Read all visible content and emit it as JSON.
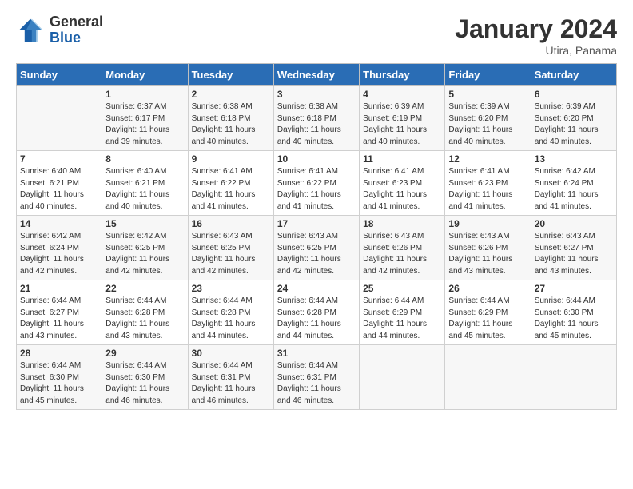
{
  "logo": {
    "general": "General",
    "blue": "Blue"
  },
  "header": {
    "title": "January 2024",
    "subtitle": "Utira, Panama"
  },
  "days_of_week": [
    "Sunday",
    "Monday",
    "Tuesday",
    "Wednesday",
    "Thursday",
    "Friday",
    "Saturday"
  ],
  "weeks": [
    [
      {
        "num": "",
        "info": ""
      },
      {
        "num": "1",
        "info": "Sunrise: 6:37 AM\nSunset: 6:17 PM\nDaylight: 11 hours\nand 39 minutes."
      },
      {
        "num": "2",
        "info": "Sunrise: 6:38 AM\nSunset: 6:18 PM\nDaylight: 11 hours\nand 40 minutes."
      },
      {
        "num": "3",
        "info": "Sunrise: 6:38 AM\nSunset: 6:18 PM\nDaylight: 11 hours\nand 40 minutes."
      },
      {
        "num": "4",
        "info": "Sunrise: 6:39 AM\nSunset: 6:19 PM\nDaylight: 11 hours\nand 40 minutes."
      },
      {
        "num": "5",
        "info": "Sunrise: 6:39 AM\nSunset: 6:20 PM\nDaylight: 11 hours\nand 40 minutes."
      },
      {
        "num": "6",
        "info": "Sunrise: 6:39 AM\nSunset: 6:20 PM\nDaylight: 11 hours\nand 40 minutes."
      }
    ],
    [
      {
        "num": "7",
        "info": "Sunrise: 6:40 AM\nSunset: 6:21 PM\nDaylight: 11 hours\nand 40 minutes."
      },
      {
        "num": "8",
        "info": "Sunrise: 6:40 AM\nSunset: 6:21 PM\nDaylight: 11 hours\nand 40 minutes."
      },
      {
        "num": "9",
        "info": "Sunrise: 6:41 AM\nSunset: 6:22 PM\nDaylight: 11 hours\nand 41 minutes."
      },
      {
        "num": "10",
        "info": "Sunrise: 6:41 AM\nSunset: 6:22 PM\nDaylight: 11 hours\nand 41 minutes."
      },
      {
        "num": "11",
        "info": "Sunrise: 6:41 AM\nSunset: 6:23 PM\nDaylight: 11 hours\nand 41 minutes."
      },
      {
        "num": "12",
        "info": "Sunrise: 6:41 AM\nSunset: 6:23 PM\nDaylight: 11 hours\nand 41 minutes."
      },
      {
        "num": "13",
        "info": "Sunrise: 6:42 AM\nSunset: 6:24 PM\nDaylight: 11 hours\nand 41 minutes."
      }
    ],
    [
      {
        "num": "14",
        "info": "Sunrise: 6:42 AM\nSunset: 6:24 PM\nDaylight: 11 hours\nand 42 minutes."
      },
      {
        "num": "15",
        "info": "Sunrise: 6:42 AM\nSunset: 6:25 PM\nDaylight: 11 hours\nand 42 minutes."
      },
      {
        "num": "16",
        "info": "Sunrise: 6:43 AM\nSunset: 6:25 PM\nDaylight: 11 hours\nand 42 minutes."
      },
      {
        "num": "17",
        "info": "Sunrise: 6:43 AM\nSunset: 6:25 PM\nDaylight: 11 hours\nand 42 minutes."
      },
      {
        "num": "18",
        "info": "Sunrise: 6:43 AM\nSunset: 6:26 PM\nDaylight: 11 hours\nand 42 minutes."
      },
      {
        "num": "19",
        "info": "Sunrise: 6:43 AM\nSunset: 6:26 PM\nDaylight: 11 hours\nand 43 minutes."
      },
      {
        "num": "20",
        "info": "Sunrise: 6:43 AM\nSunset: 6:27 PM\nDaylight: 11 hours\nand 43 minutes."
      }
    ],
    [
      {
        "num": "21",
        "info": "Sunrise: 6:44 AM\nSunset: 6:27 PM\nDaylight: 11 hours\nand 43 minutes."
      },
      {
        "num": "22",
        "info": "Sunrise: 6:44 AM\nSunset: 6:28 PM\nDaylight: 11 hours\nand 43 minutes."
      },
      {
        "num": "23",
        "info": "Sunrise: 6:44 AM\nSunset: 6:28 PM\nDaylight: 11 hours\nand 44 minutes."
      },
      {
        "num": "24",
        "info": "Sunrise: 6:44 AM\nSunset: 6:28 PM\nDaylight: 11 hours\nand 44 minutes."
      },
      {
        "num": "25",
        "info": "Sunrise: 6:44 AM\nSunset: 6:29 PM\nDaylight: 11 hours\nand 44 minutes."
      },
      {
        "num": "26",
        "info": "Sunrise: 6:44 AM\nSunset: 6:29 PM\nDaylight: 11 hours\nand 45 minutes."
      },
      {
        "num": "27",
        "info": "Sunrise: 6:44 AM\nSunset: 6:30 PM\nDaylight: 11 hours\nand 45 minutes."
      }
    ],
    [
      {
        "num": "28",
        "info": "Sunrise: 6:44 AM\nSunset: 6:30 PM\nDaylight: 11 hours\nand 45 minutes."
      },
      {
        "num": "29",
        "info": "Sunrise: 6:44 AM\nSunset: 6:30 PM\nDaylight: 11 hours\nand 46 minutes."
      },
      {
        "num": "30",
        "info": "Sunrise: 6:44 AM\nSunset: 6:31 PM\nDaylight: 11 hours\nand 46 minutes."
      },
      {
        "num": "31",
        "info": "Sunrise: 6:44 AM\nSunset: 6:31 PM\nDaylight: 11 hours\nand 46 minutes."
      },
      {
        "num": "",
        "info": ""
      },
      {
        "num": "",
        "info": ""
      },
      {
        "num": "",
        "info": ""
      }
    ]
  ]
}
